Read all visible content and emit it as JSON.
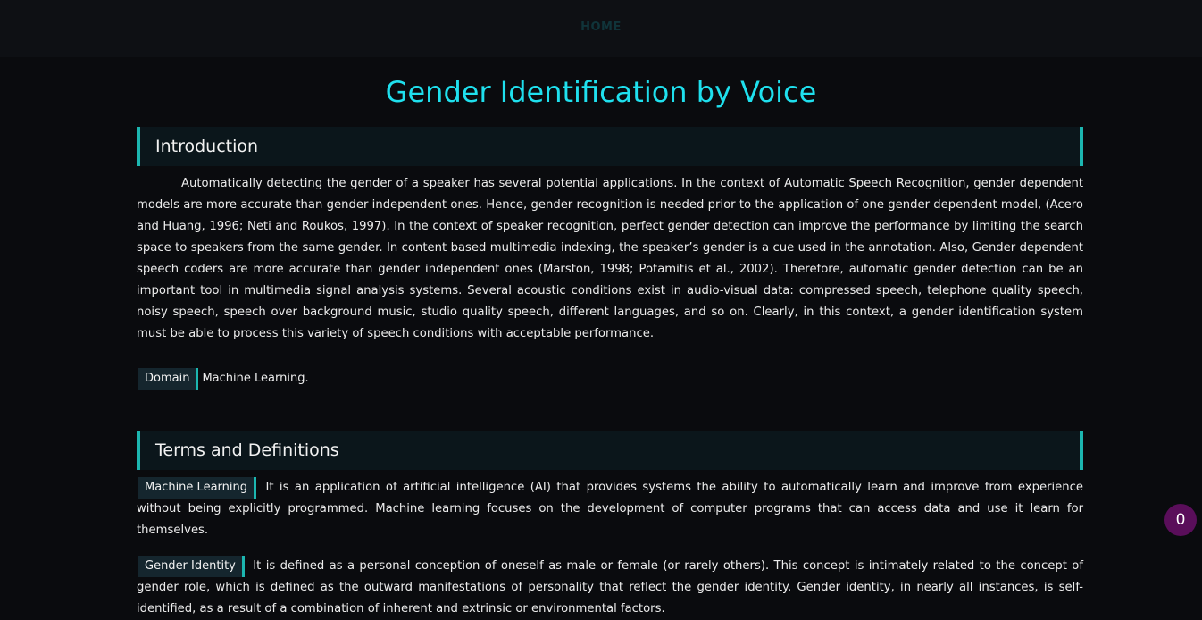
{
  "nav": {
    "home_label": "HOME"
  },
  "page": {
    "title": "Gender Identification by Voice"
  },
  "introduction": {
    "heading": "Introduction",
    "text": "Automatically detecting the gender of a speaker has several potential applications. In the context of Automatic Speech Recognition, gender dependent models are more accurate than gender independent ones. Hence, gender recognition is needed prior to the application of one gender dependent model, (Acero and Huang, 1996; Neti and Roukos, 1997). In the context of speaker recognition, perfect gender detection can improve the performance by limiting the search space to speakers from the same gender. In content based multimedia indexing, the speaker’s gender is a cue used in the annotation. Also, Gender dependent speech coders are more accurate than gender independent ones (Marston, 1998; Potamitis et al., 2002). Therefore, automatic gender detection can be an important tool in multimedia signal analysis systems. Several acoustic conditions exist in audio-visual data: compressed speech, telephone quality speech, noisy speech, speech over background music, studio quality speech, different languages, and so on. Clearly, in this context, a gender identification system must be able to process this variety of speech conditions with acceptable performance.",
    "domain_label": "Domain",
    "domain_value": "Machine Learning."
  },
  "terms": {
    "heading": "Terms and Definitions",
    "items": [
      {
        "term": "Machine Learning",
        "definition": "It is an application of artificial intelligence (AI) that provides systems the ability to automatically learn and improve from experience without being explicitly programmed. Machine learning focuses on the development of computer programs that can access data and use it learn for themselves."
      },
      {
        "term": "Gender Identity",
        "definition": "It is defined as a personal conception of oneself as male or female (or rarely others). This concept is intimately related to the concept of gender role, which is defined as the outward manifestations of personality that reflect the gender identity. Gender identity, in nearly all instances, is self-identified, as a result of a combination of inherent and extrinsic or environmental factors."
      }
    ]
  },
  "floating_badge": {
    "count": "0"
  },
  "colors": {
    "accent": "#1cb6b0",
    "title": "#1fe0ee",
    "background": "#0a0b0e",
    "badge": "#5a0e5a"
  }
}
